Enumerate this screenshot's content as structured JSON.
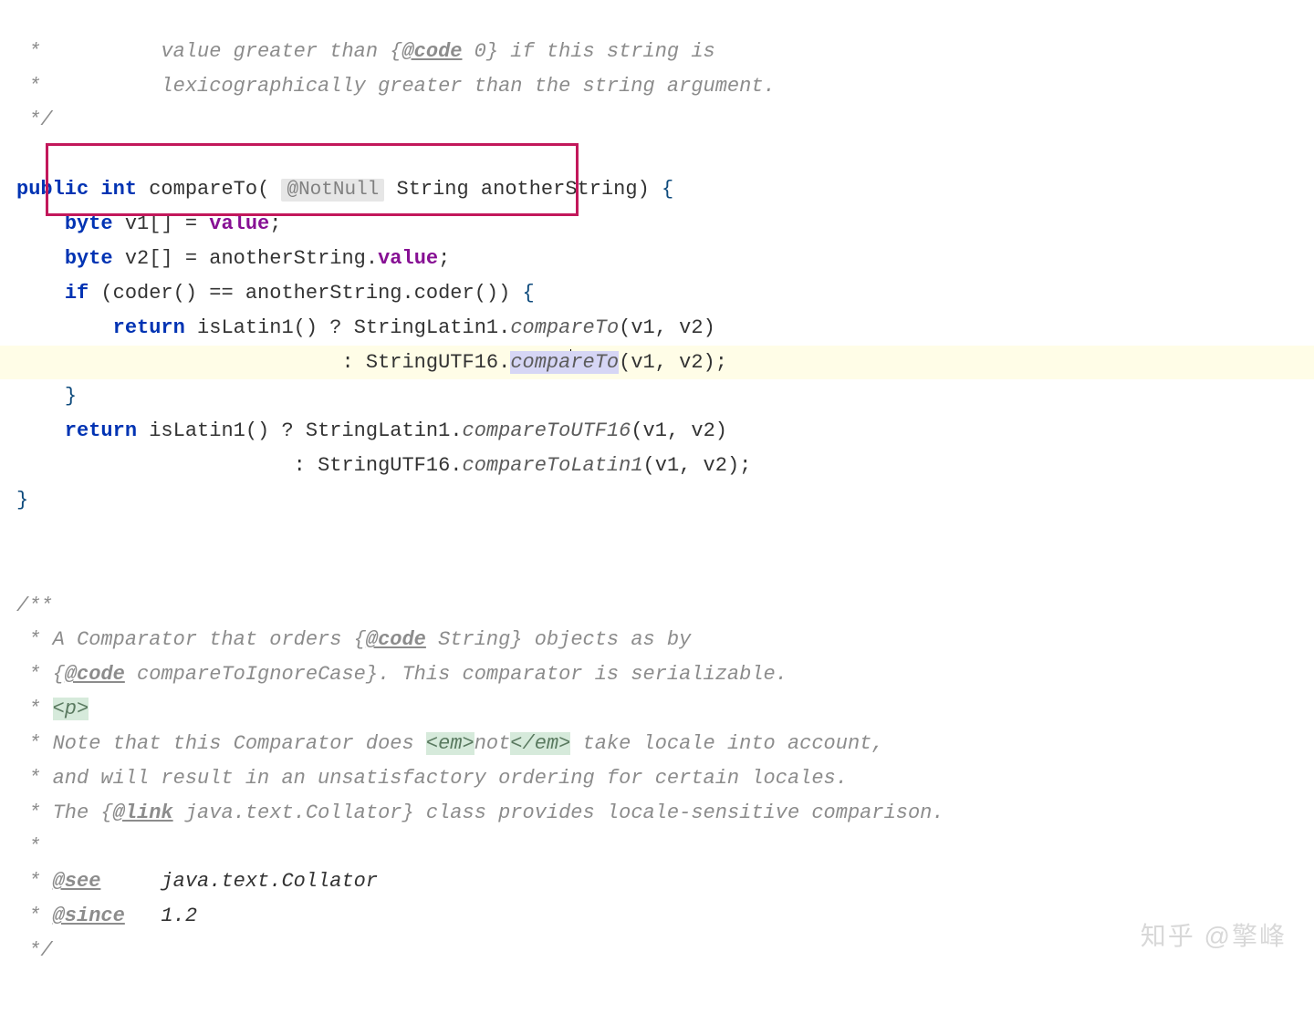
{
  "doc1": {
    "line1_prefix": " *          value greater than {",
    "line1_tag": "@code",
    "line1_rest": " 0} if this string is",
    "line2": " *          lexicographically greater than the string argument.",
    "line3": " */"
  },
  "method": {
    "kw_public": "public",
    "kw_int": "int",
    "name": "compareTo",
    "annotation": "@NotNull",
    "paramType": "String",
    "paramName": "anotherString",
    "l_byte": "byte",
    "l_v1": "v1",
    "l_v2": "v2",
    "l_arr": "[]",
    "l_eq": " = ",
    "l_value": "value",
    "l_another": "anotherString",
    "l_dot": ".",
    "l_semi": ";",
    "kw_if": "if",
    "coder": "coder",
    "eqeq": " == ",
    "kw_return": "return",
    "isLatin1": "isLatin1",
    "q": " ? ",
    "colon": " : ",
    "StringLatin1": "StringLatin1",
    "StringUTF16": "StringUTF16",
    "compareTo": "compareTo",
    "compa": "compa",
    "reTo_rest": "reTo",
    "args": "(v1, v2)",
    "compareToUTF16": "compareToUTF16",
    "compareToLatin1": "compareToLatin1"
  },
  "doc2": {
    "open": "/**",
    "l1_a": " * A Comparator that orders {",
    "l1_tag": "@code",
    "l1_b": " String} objects as by",
    "l2_a": " * {",
    "l2_tag": "@code",
    "l2_b": " compareToIgnoreCase}. This comparator is serializable.",
    "l3_a": " * ",
    "l3_p": "<p>",
    "l4_a": " * Note that this Comparator does ",
    "l4_em_o": "<em>",
    "l4_not": "not",
    "l4_em_c": "</em>",
    "l4_b": " take locale into account,",
    "l5": " * and will result in an unsatisfactory ordering for certain locales.",
    "l6_a": " * The {",
    "l6_tag": "@link",
    "l6_b": " java.text.Collator} class provides locale-sensitive comparison.",
    "l7": " *",
    "l8_a": " * ",
    "l8_tag": "@see",
    "l8_val": "     java.text.Collator",
    "l9_a": " * ",
    "l9_tag": "@since",
    "l9_val": "   1.2",
    "close": " */"
  },
  "watermark": "知乎 @擎峰"
}
